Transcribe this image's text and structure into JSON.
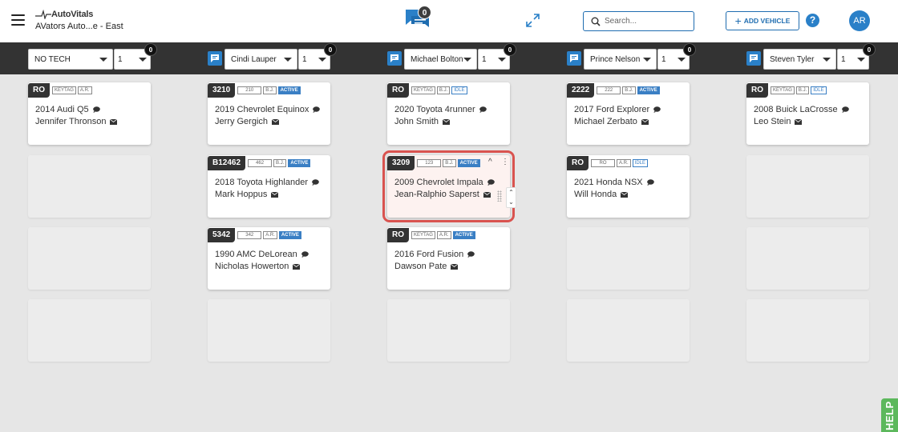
{
  "header": {
    "logo_text": "AutoVitals",
    "shop_name": "AVators Auto...e - East",
    "chat_count": "0",
    "search_placeholder": "Search...",
    "add_vehicle_label": "ADD VEHICLE",
    "help_label": "?",
    "avatar_initials": "AR"
  },
  "techs": [
    {
      "name": "NO TECH",
      "count": "1",
      "badge": "0"
    },
    {
      "name": "Cindi Lauper",
      "count": "1",
      "badge": "0"
    },
    {
      "name": "Michael Bolton",
      "count": "1",
      "badge": "0"
    },
    {
      "name": "Prince Nelson",
      "count": "1",
      "badge": "0"
    },
    {
      "name": "Steven Tyler",
      "count": "1",
      "badge": "0"
    }
  ],
  "cards": {
    "c0_0": {
      "ro": "RO",
      "pill1": "KEYTAG",
      "pill2": "A.R.",
      "vehicle": "2014 Audi Q5",
      "customer": "Jennifer Thronson"
    },
    "c1_0": {
      "ro": "3210",
      "pill1": "210",
      "pill2": "B.J.",
      "pill3": "ACTIVE",
      "vehicle": "2019 Chevrolet Equinox",
      "customer": "Jerry Gergich"
    },
    "c1_1": {
      "ro": "B12462",
      "pill1": "462",
      "pill2": "B.J.",
      "pill3": "ACTIVE",
      "vehicle": "2018 Toyota Highlander",
      "customer": "Mark Hoppus"
    },
    "c1_2": {
      "ro": "5342",
      "pill1": "342",
      "pill2": "A.R.",
      "pill3": "ACTIVE",
      "vehicle": "1990 AMC DeLorean",
      "customer": "Nicholas Howerton"
    },
    "c2_0": {
      "ro": "RO",
      "pill1": "KEYTAG",
      "pill2": "B.J.",
      "pill3": "IDLE",
      "vehicle": "2020 Toyota 4runner",
      "customer": "John Smith"
    },
    "c2_1": {
      "ro": "3209",
      "pill1": "123",
      "pill2": "B.J.",
      "pill3": "ACTIVE",
      "vehicle": "2009 Chevrolet Impala",
      "customer": "Jean-Ralphio Saperstein",
      "collapse": "^",
      "menu": "⋮",
      "up": "⌃",
      "down": "⌄"
    },
    "c2_2": {
      "ro": "RO",
      "pill1": "KEYTAG",
      "pill2": "A.R.",
      "pill3": "ACTIVE",
      "vehicle": "2016 Ford Fusion",
      "customer": "Dawson Pate"
    },
    "c3_0": {
      "ro": "2222",
      "pill1": "222",
      "pill2": "B.J.",
      "pill3": "ACTIVE",
      "vehicle": "2017 Ford Explorer",
      "customer": "Michael Zerbato"
    },
    "c3_1": {
      "ro": "RO",
      "pill1": "RO",
      "pill2": "A.R.",
      "pill3": "IDLE",
      "vehicle": "2021 Honda NSX",
      "customer": "Will Honda"
    },
    "c4_0": {
      "ro": "RO",
      "pill1": "KEYTAG",
      "pill2": "B.J.",
      "pill3": "IDLE",
      "vehicle": "2008 Buick LaCrosse",
      "customer": "Leo Stein"
    }
  },
  "help_tab": "HELP",
  "colors": {
    "accent": "#2a80c8",
    "active": "#3a7fc4",
    "selected_outline": "#d9534f",
    "techbar": "#333333",
    "help": "#5cb85c"
  }
}
